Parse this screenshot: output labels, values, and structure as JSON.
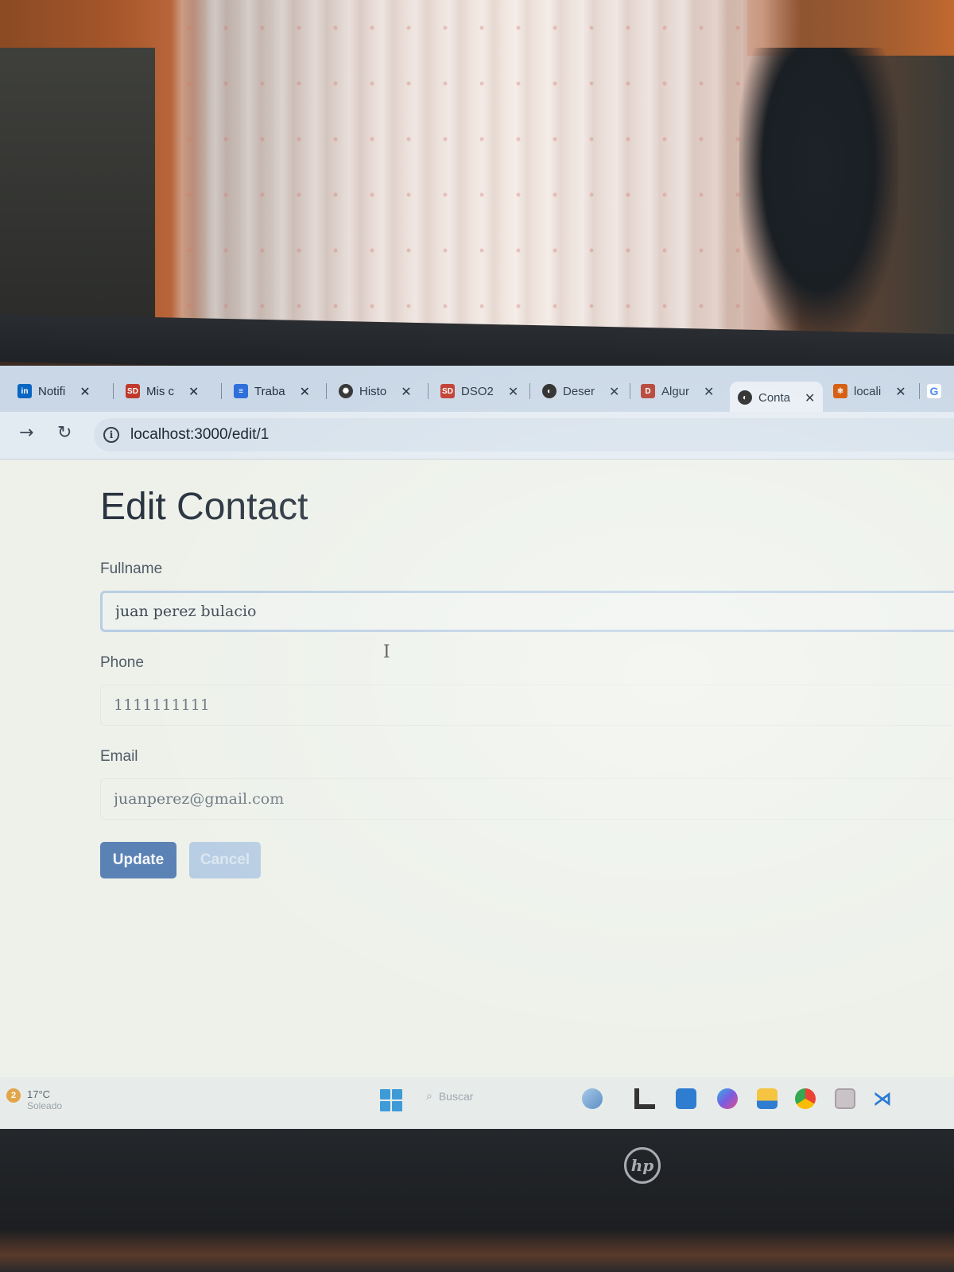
{
  "browser": {
    "tabs": [
      {
        "label": "Notifi",
        "favicon": "linkedin-icon",
        "favicon_text": "in",
        "color": "#0a66c2"
      },
      {
        "label": "Mis c",
        "favicon": "sd-icon",
        "favicon_text": "SD",
        "color": "#c0392b"
      },
      {
        "label": "Traba",
        "favicon": "docs-icon",
        "favicon_text": "≡",
        "color": "#2f6fdc"
      },
      {
        "label": "Histo",
        "favicon": "chatgpt-icon",
        "favicon_text": "✺",
        "color": "#333333"
      },
      {
        "label": "DSO2",
        "favicon": "sd-icon",
        "favicon_text": "SD",
        "color": "#c0392b"
      },
      {
        "label": "Deser",
        "favicon": "globe-icon",
        "favicon_text": "◐",
        "color": "#222222"
      },
      {
        "label": "Algur",
        "favicon": "d-icon",
        "favicon_text": "D",
        "color": "#b23b2e"
      },
      {
        "label": "Conta",
        "favicon": "globe-icon",
        "favicon_text": "◐",
        "color": "#222222"
      },
      {
        "label": "locali",
        "favicon": "react-icon",
        "favicon_text": "⚛",
        "color": "#d35400"
      }
    ],
    "close_glyph": "✕",
    "address": "localhost:3000/edit/1"
  },
  "form": {
    "title": "Edit Contact",
    "fullname_label": "Fullname",
    "fullname_value": "juan perez bulacio",
    "phone_label": "Phone",
    "phone_value": "1111111111",
    "email_label": "Email",
    "email_value": "juanperez@gmail.com",
    "update_label": "Update",
    "cancel_label": "Cancel"
  },
  "taskbar": {
    "weather_badge": "2",
    "weather_temp": "17°C",
    "weather_desc": "Soleado",
    "search_placeholder": "Buscar"
  },
  "laptop_brand": "hp",
  "colors": {
    "update_button": "#5b82b4",
    "cancel_button": "#b7cde3",
    "tab_strip": "#c9d7e6"
  }
}
